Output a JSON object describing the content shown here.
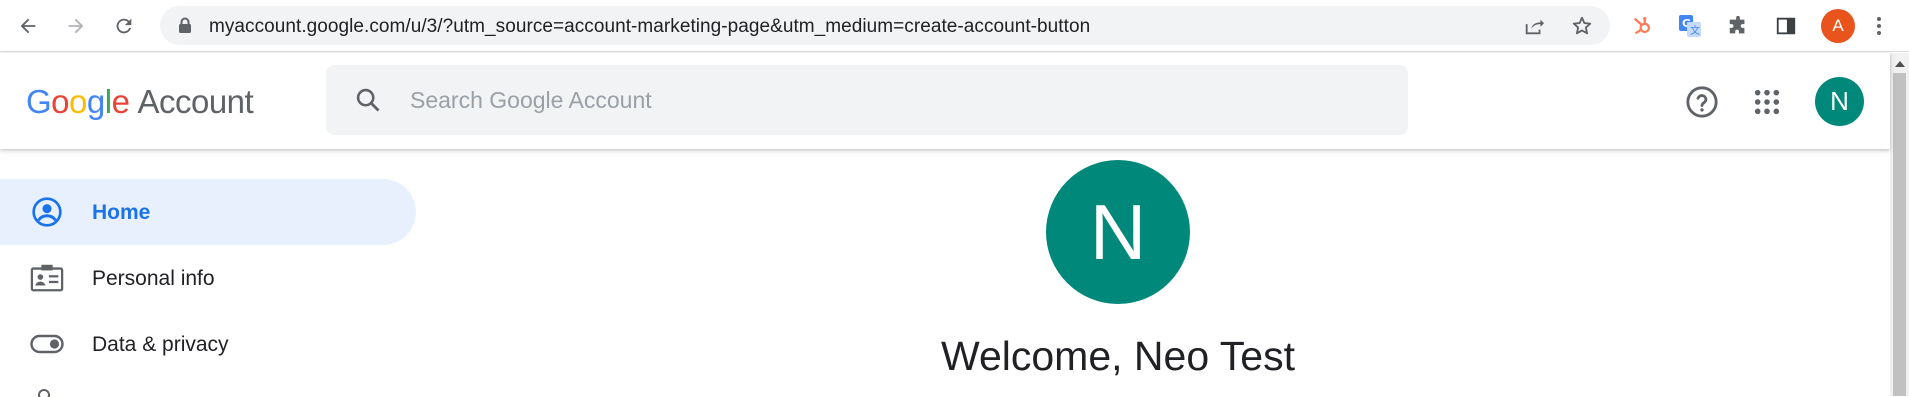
{
  "browser": {
    "url": "myaccount.google.com/u/3/?utm_source=account-marketing-page&utm_medium=create-account-button",
    "profile_initial": "A",
    "nav_icons": [
      "back-arrow-icon",
      "forward-arrow-icon",
      "reload-icon"
    ],
    "omnibox_icons": [
      "share-icon",
      "bookmark-star-icon"
    ],
    "extension_icons": [
      "hubspot-icon",
      "google-translate-icon",
      "extensions-puzzle-icon",
      "side-panel-icon"
    ],
    "menu_icon": "more-vert-icon"
  },
  "header": {
    "logo_letters": [
      "G",
      "o",
      "o",
      "g",
      "l",
      "e"
    ],
    "logo_suffix": "Account",
    "search_placeholder": "Search Google Account",
    "search_value": "",
    "help_icon": "help-circle-icon",
    "apps_icon": "apps-grid-icon",
    "avatar_initial": "N",
    "accent": "#1a73e8",
    "avatar_color": "#00897b"
  },
  "sidebar": {
    "items": [
      {
        "label": "Home",
        "icon": "account-circle-icon",
        "active": true
      },
      {
        "label": "Personal info",
        "icon": "id-card-icon",
        "active": false
      },
      {
        "label": "Data & privacy",
        "icon": "toggle-icon",
        "active": false
      }
    ]
  },
  "main": {
    "avatar_initial": "N",
    "welcome": "Welcome, Neo Test"
  }
}
